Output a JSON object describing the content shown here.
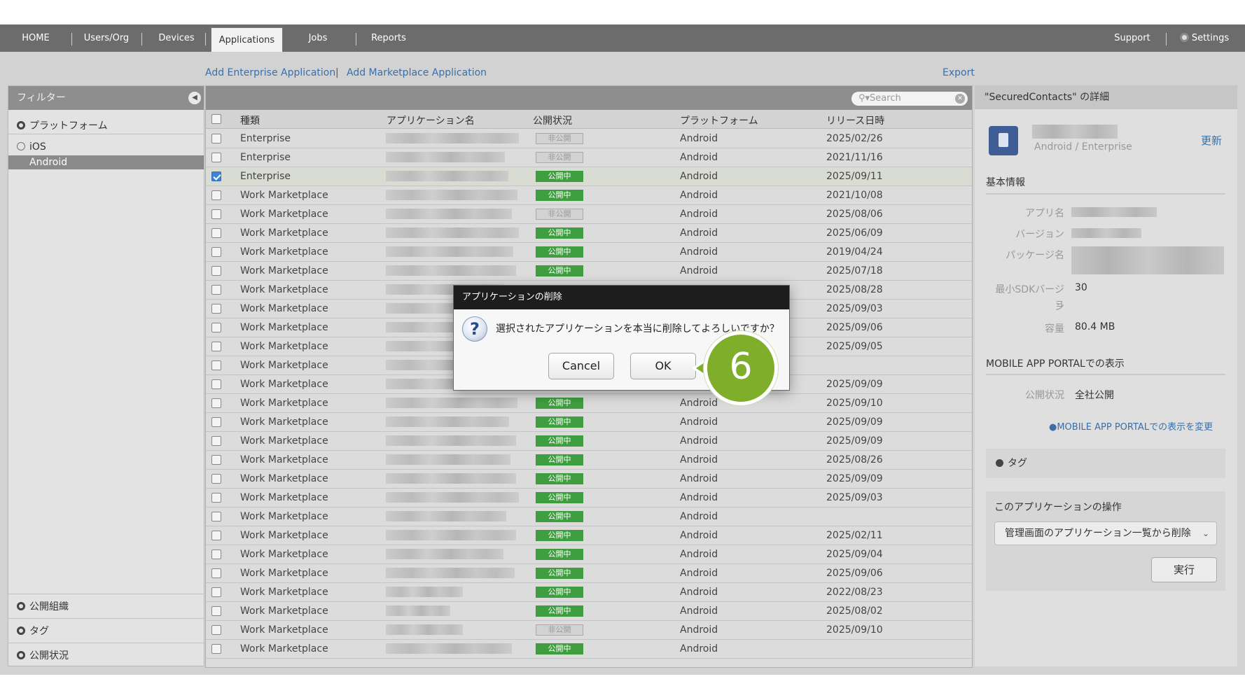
{
  "nav": {
    "items": [
      "HOME",
      "Users/Org",
      "Devices",
      "Applications",
      "Jobs",
      "Reports"
    ],
    "support": "Support",
    "settings": "Settings"
  },
  "actions": {
    "add_enterprise": "Add Enterprise Application",
    "separator": "|",
    "add_marketplace": "Add Marketplace Application",
    "export": "Export"
  },
  "filter": {
    "title": "フィルター",
    "platform": "プラットフォーム",
    "ios": "iOS",
    "android": "Android",
    "org": "公開組織",
    "tag": "タグ",
    "status": "公開状況"
  },
  "table": {
    "search_placeholder": "Search",
    "headers": [
      "種類",
      "アプリケーション名",
      "公開状況",
      "プラットフォーム",
      "リリース日時"
    ],
    "rows": [
      {
        "type": "Enterprise",
        "status": "非公開",
        "platform": "Android",
        "date": "2025/02/26"
      },
      {
        "type": "Enterprise",
        "status": "非公開",
        "platform": "Android",
        "date": "2021/11/16"
      },
      {
        "type": "Enterprise",
        "status": "公開中",
        "platform": "Android",
        "date": "2025/09/11"
      },
      {
        "type": "Work Marketplace",
        "status": "公開中",
        "platform": "Android",
        "date": "2021/10/08"
      },
      {
        "type": "Work Marketplace",
        "status": "非公開",
        "platform": "Android",
        "date": "2025/08/06"
      },
      {
        "type": "Work Marketplace",
        "status": "公開中",
        "platform": "Android",
        "date": "2025/06/09"
      },
      {
        "type": "Work Marketplace",
        "status": "公開中",
        "platform": "Android",
        "date": "2019/04/24"
      },
      {
        "type": "Work Marketplace",
        "status": "公開中",
        "platform": "Android",
        "date": "2025/07/18"
      },
      {
        "type": "Work Marketplace",
        "status": "",
        "platform": "",
        "date": "2025/08/28"
      },
      {
        "type": "Work Marketplace",
        "status": "",
        "platform": "",
        "date": "2025/09/03"
      },
      {
        "type": "Work Marketplace",
        "status": "",
        "platform": "",
        "date": "2025/09/06"
      },
      {
        "type": "Work Marketplace",
        "status": "",
        "platform": "",
        "date": "2025/09/05"
      },
      {
        "type": "Work Marketplace",
        "status": "",
        "platform": "",
        "date": ""
      },
      {
        "type": "Work Marketplace",
        "status": "",
        "platform": "",
        "date": "2025/09/09"
      },
      {
        "type": "Work Marketplace",
        "status": "公開中",
        "platform": "Android",
        "date": "2025/09/10"
      },
      {
        "type": "Work Marketplace",
        "status": "公開中",
        "platform": "Android",
        "date": "2025/09/09"
      },
      {
        "type": "Work Marketplace",
        "status": "公開中",
        "platform": "Android",
        "date": "2025/09/09"
      },
      {
        "type": "Work Marketplace",
        "status": "公開中",
        "platform": "Android",
        "date": "2025/08/26"
      },
      {
        "type": "Work Marketplace",
        "status": "公開中",
        "platform": "Android",
        "date": "2025/09/09"
      },
      {
        "type": "Work Marketplace",
        "status": "公開中",
        "platform": "Android",
        "date": "2025/09/03"
      },
      {
        "type": "Work Marketplace",
        "status": "公開中",
        "platform": "Android",
        "date": ""
      },
      {
        "type": "Work Marketplace",
        "status": "公開中",
        "platform": "Android",
        "date": "2025/02/11"
      },
      {
        "type": "Work Marketplace",
        "status": "公開中",
        "platform": "Android",
        "date": "2025/09/04"
      },
      {
        "type": "Work Marketplace",
        "status": "公開中",
        "platform": "Android",
        "date": "2025/09/06"
      },
      {
        "type": "Work Marketplace",
        "status": "公開中",
        "platform": "Android",
        "date": "2022/08/23"
      },
      {
        "type": "Work Marketplace",
        "status": "公開中",
        "platform": "Android",
        "date": "2025/08/02"
      },
      {
        "type": "Work Marketplace",
        "status": "非公開",
        "platform": "Android",
        "date": "2025/09/10"
      },
      {
        "type": "Work Marketplace",
        "status": "公開中",
        "platform": "Android",
        "date": ""
      }
    ],
    "selected_row": 2
  },
  "detail": {
    "title": "\"SecuredContacts\" の詳細",
    "subtitle": "Android / Enterprise",
    "update": "更新",
    "basic_info": "基本情報",
    "labels": {
      "app_name": "アプリ名",
      "version": "バージョン",
      "package": "パッケージ名",
      "min_sdk": "最小SDKバージョ",
      "min_sdk_wrap": "ン",
      "size": "容量"
    },
    "min_sdk_value": "30",
    "size_value": "80.4 MB",
    "portal_title": "MOBILE APP PORTALでの表示",
    "portal_status_label": "公開状況",
    "portal_status_value": "全社公開",
    "portal_change": "MOBILE APP PORTALでの表示を変更",
    "tag": "タグ",
    "ops_title": "このアプリケーションの操作",
    "ops_select": "管理画面のアプリケーション一覧から削除",
    "run": "実行"
  },
  "dialog": {
    "title": "アプリケーションの削除",
    "message": "選択されたアプリケーションを本当に削除してよろしいですか？",
    "cancel": "Cancel",
    "ok": "OK"
  },
  "step_marker": "6",
  "colors": {
    "nav_bg": "#6c6c6c",
    "published": "#3f9e3f",
    "link": "#3a6fa8",
    "step": "#7fae2b"
  }
}
